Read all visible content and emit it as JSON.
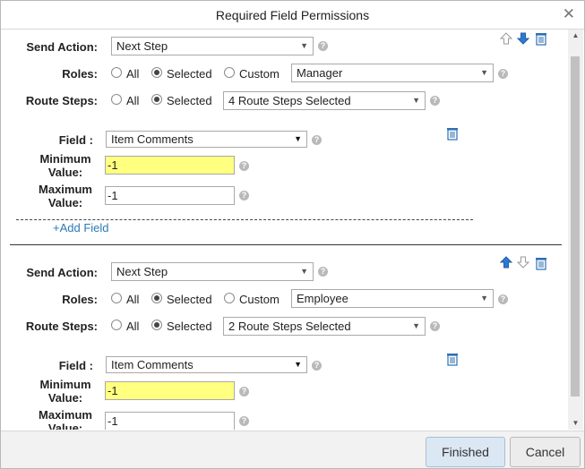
{
  "dialog": {
    "title": "Required Field Permissions"
  },
  "labels": {
    "send_action": "Send Action:",
    "roles": "Roles:",
    "route_steps": "Route Steps:",
    "field": "Field :",
    "minimum_value": "Minimum Value:",
    "maximum_value": "Maximum Value:",
    "radio_all": "All",
    "radio_selected": "Selected",
    "radio_custom": "Custom"
  },
  "rules": [
    {
      "send_action": "Next Step",
      "roles_selected_option": "Selected",
      "role_value": "Manager",
      "route_steps_selected_option": "Selected",
      "route_steps_value": "4 Route Steps Selected",
      "field": "Item Comments",
      "minimum_value": "-1",
      "maximum_value": "-1",
      "add_field_link": "+Add Field"
    },
    {
      "send_action": "Next Step",
      "roles_selected_option": "Selected",
      "role_value": "Employee",
      "route_steps_selected_option": "Selected",
      "route_steps_value": "2 Route Steps Selected",
      "field": "Item Comments",
      "minimum_value": "-1",
      "maximum_value": "-1"
    }
  ],
  "footer": {
    "finished_label": "Finished",
    "cancel_label": "Cancel"
  },
  "colors": {
    "accent_blue": "#2a7ab8",
    "highlight_yellow": "#ffff80",
    "finished_bg": "#dbe7f3"
  }
}
